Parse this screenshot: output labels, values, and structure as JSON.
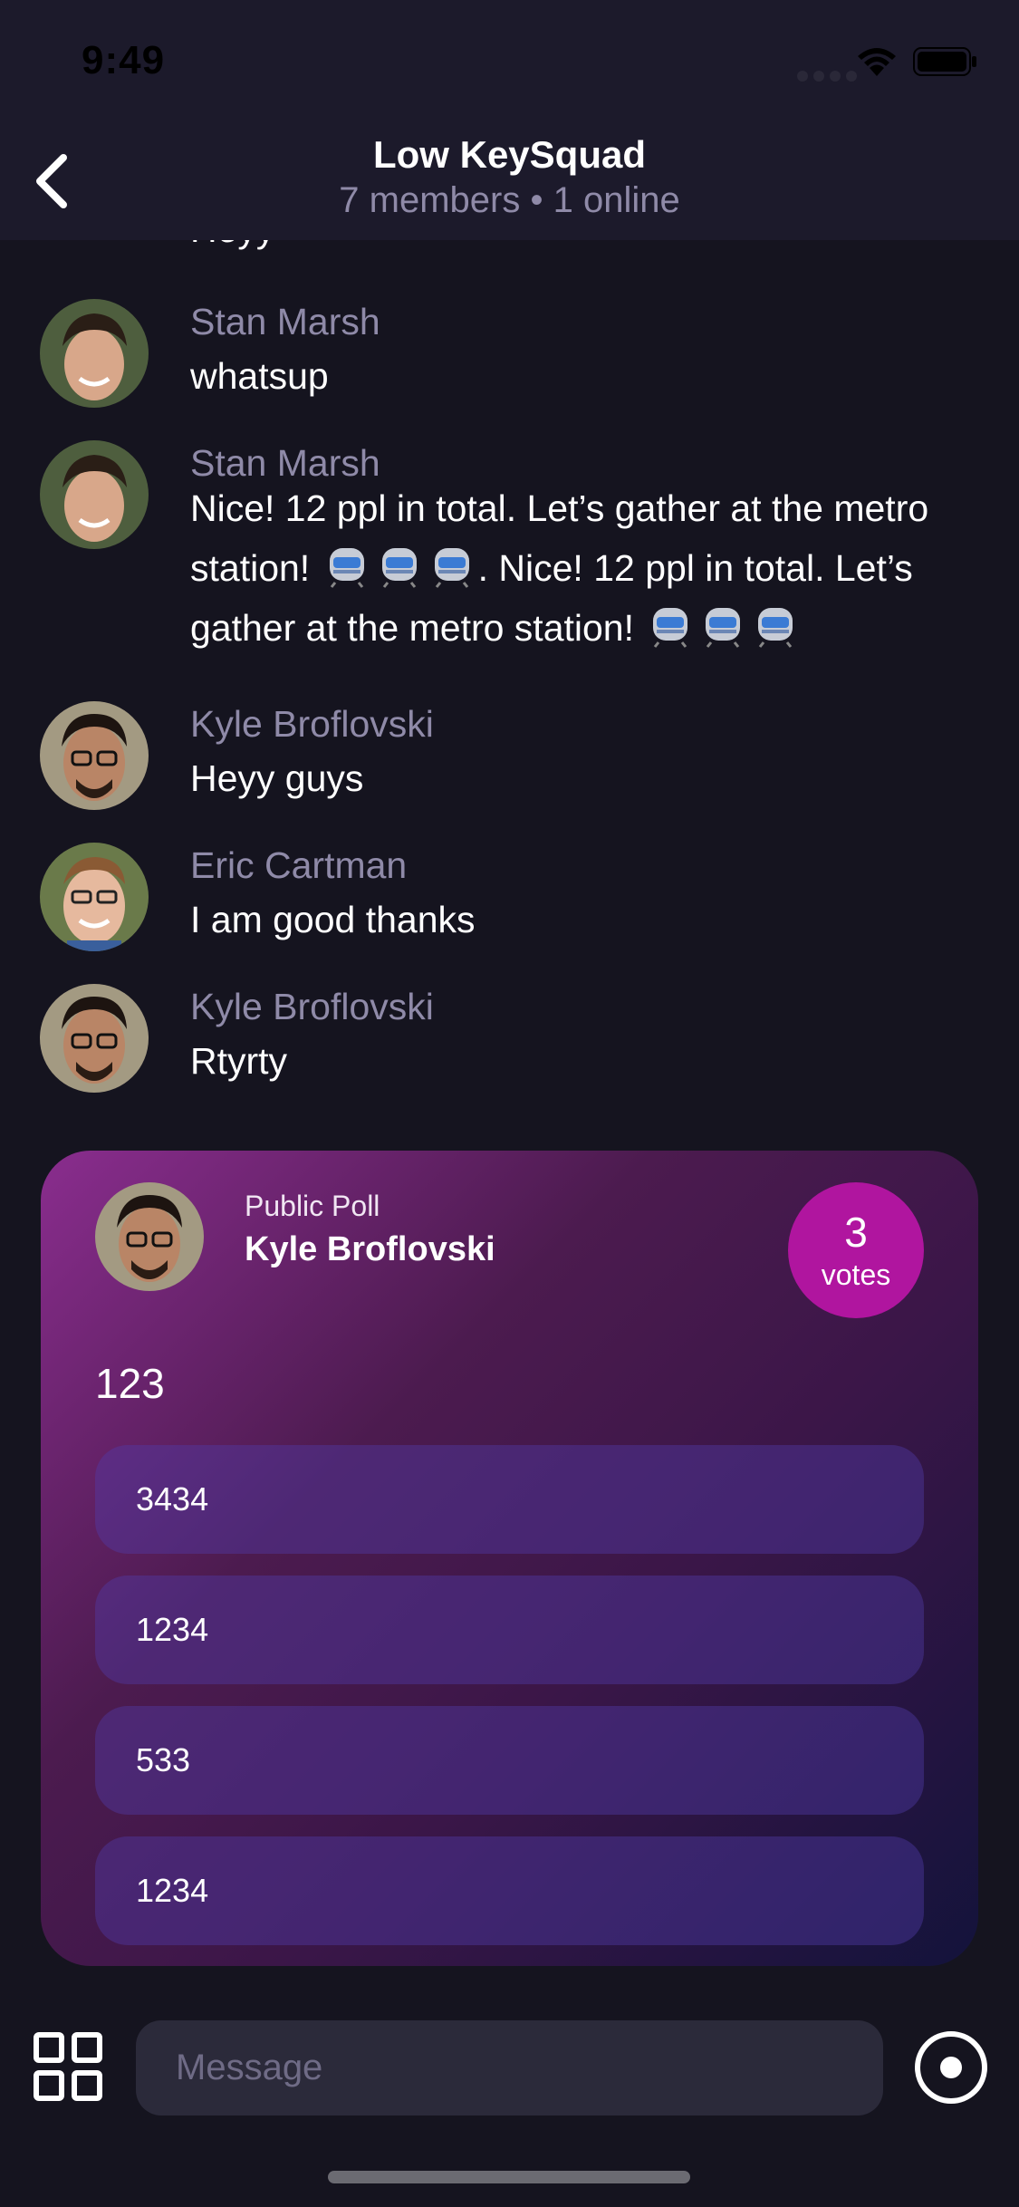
{
  "status_bar": {
    "time": "9:49"
  },
  "header": {
    "title": "Low KeySquad",
    "subtitle": "7 members • 1 online"
  },
  "messages": [
    {
      "name": "",
      "text": "Heyy"
    },
    {
      "name": "Stan Marsh",
      "text": "whatsup"
    },
    {
      "name": "Stan Marsh",
      "text_a": "Nice! 12 ppl in total. Let’s gather at the metro station!",
      "text_b": ". Nice! 12 ppl in total. Let’s gather at the metro station!"
    },
    {
      "name": "Kyle Broflovski",
      "text": "Heyy guys"
    },
    {
      "name": "Eric Cartman",
      "text": "I am good thanks"
    },
    {
      "name": "Kyle Broflovski",
      "text": "Rtyrty"
    }
  ],
  "poll": {
    "type_label": "Public Poll",
    "author": "Kyle Broflovski",
    "votes_count": "3",
    "votes_label": "votes",
    "question": "123",
    "options": [
      "3434",
      "1234",
      "533",
      "1234"
    ]
  },
  "composer": {
    "placeholder": "Message"
  },
  "icons": {
    "back": "chevron-left-icon",
    "apps": "grid-icon",
    "record": "record-icon",
    "emoji": "train-emoji"
  }
}
